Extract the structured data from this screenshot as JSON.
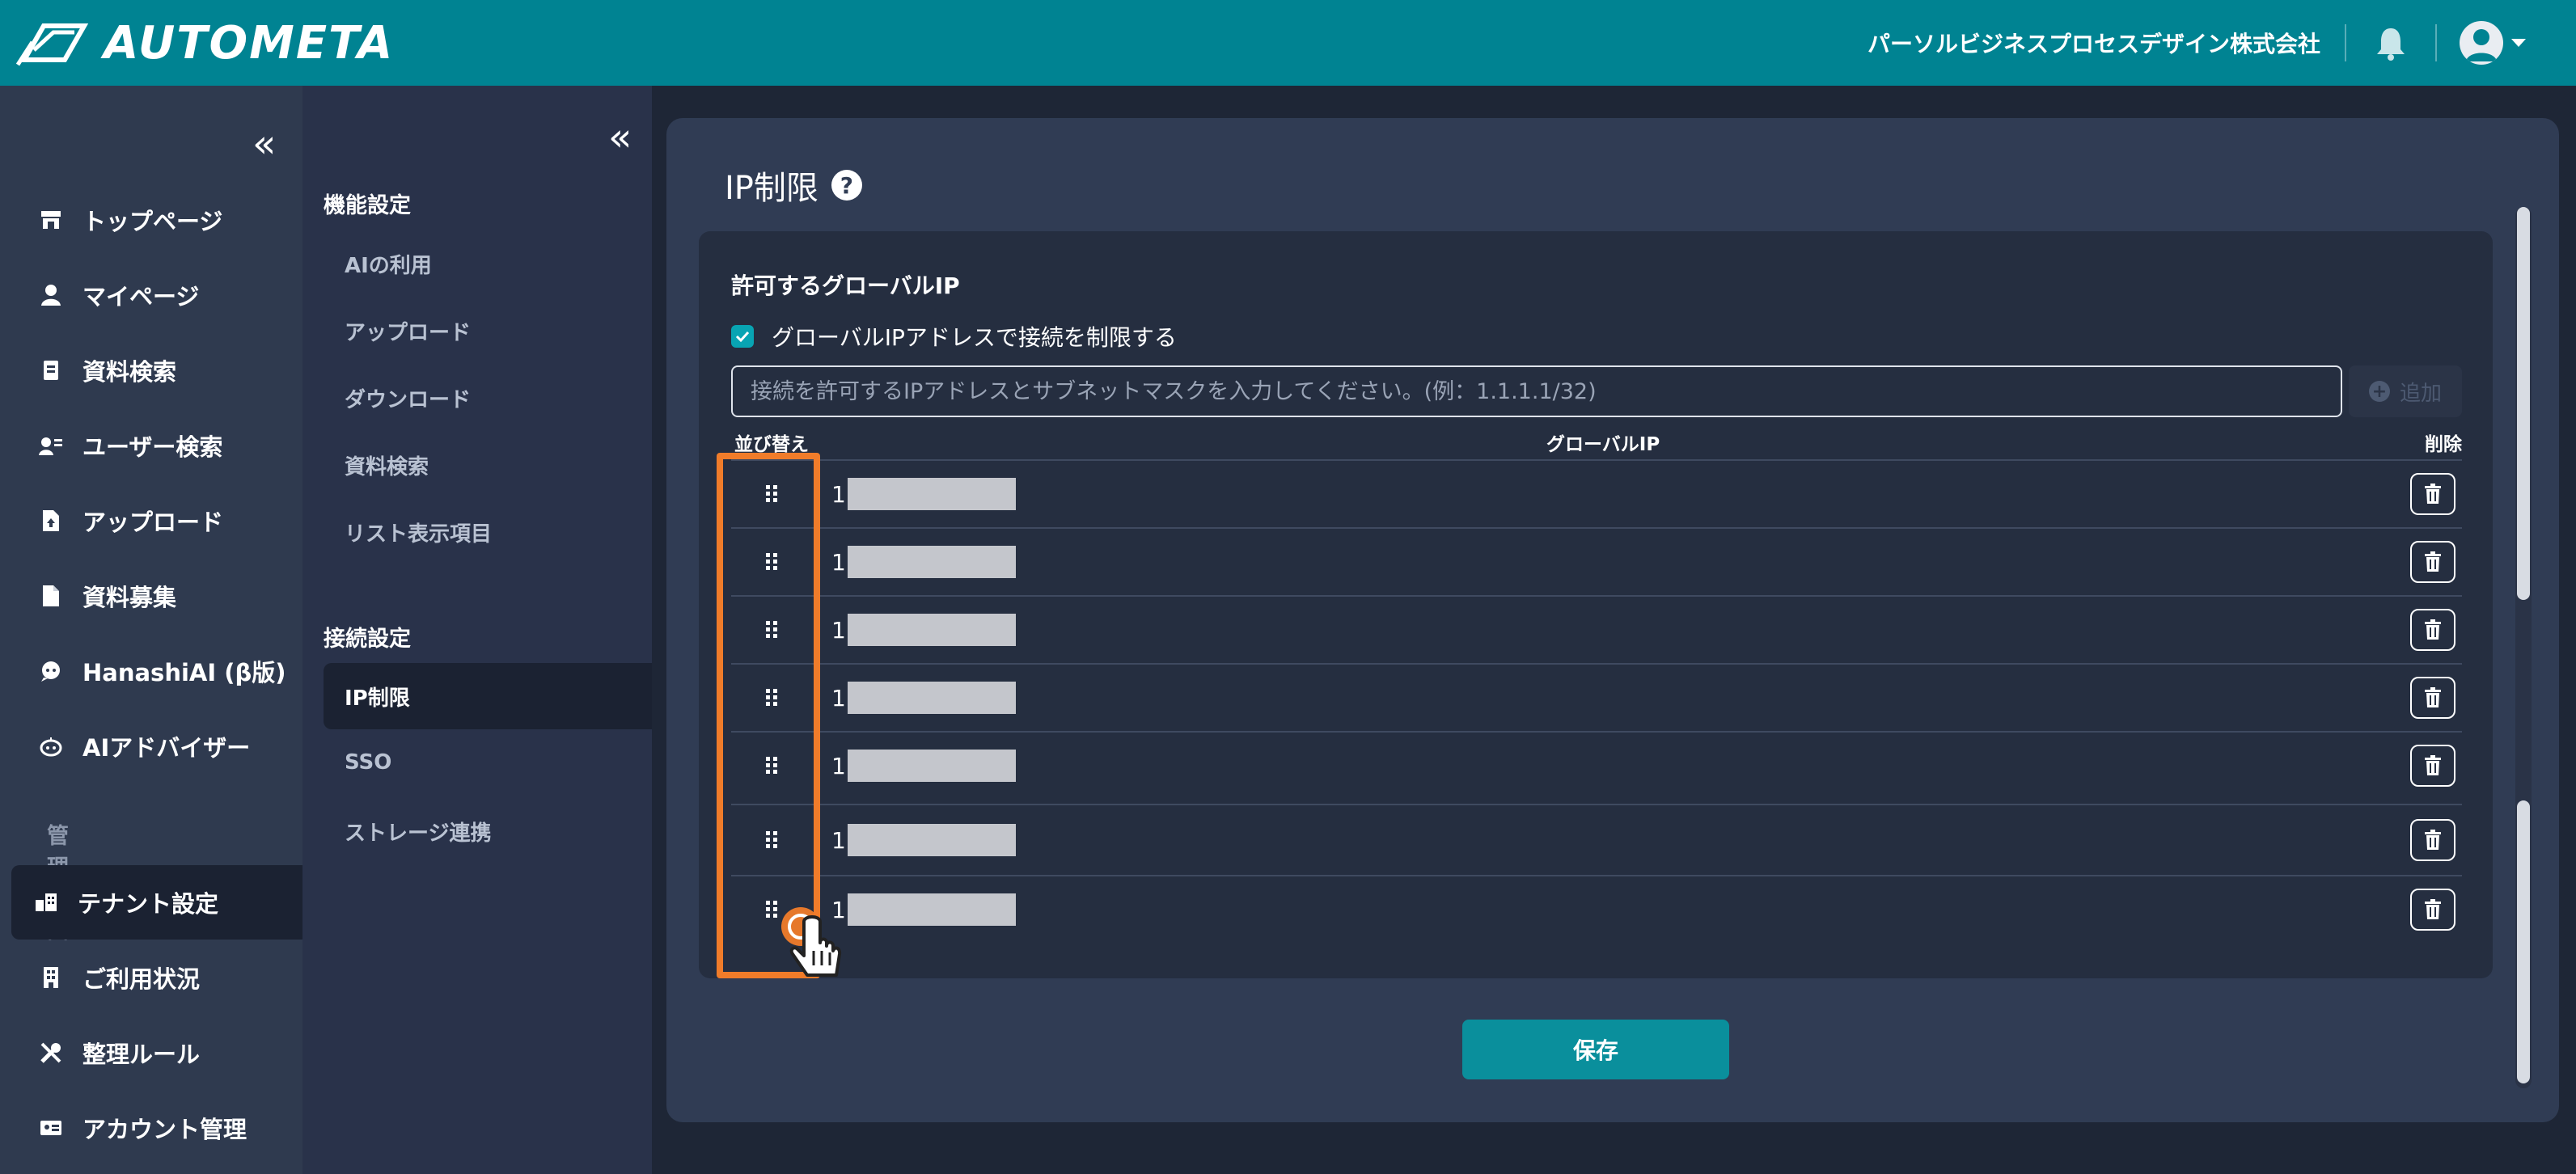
{
  "header": {
    "app_name": "AUTOMETA",
    "company": "パーソルビジネスプロセスデザイン株式会社"
  },
  "nav1": {
    "items": [
      {
        "label": "トップページ",
        "icon": "store-icon"
      },
      {
        "label": "マイページ",
        "icon": "person-icon"
      },
      {
        "label": "資料検索",
        "icon": "document-search-icon"
      },
      {
        "label": "ユーザー検索",
        "icon": "user-search-icon"
      },
      {
        "label": "アップロード",
        "icon": "file-upload-icon"
      },
      {
        "label": "資料募集",
        "icon": "file-icon"
      },
      {
        "label": "HanashiAI (β版)",
        "icon": "chat-icon"
      },
      {
        "label": "AIアドバイザー",
        "icon": "robot-icon"
      }
    ],
    "section_admin": "管理画面",
    "admin_items": [
      {
        "label": "テナント設定",
        "icon": "building-icon",
        "active": true
      },
      {
        "label": "ご利用状況",
        "icon": "office-icon"
      },
      {
        "label": "整理ルール",
        "icon": "tools-icon"
      },
      {
        "label": "アカウント管理",
        "icon": "id-card-icon"
      }
    ]
  },
  "nav2": {
    "section_features": "機能設定",
    "feature_items": [
      "AIの利用",
      "アップロード",
      "ダウンロード",
      "資料検索",
      "リスト表示項目"
    ],
    "section_connection": "接続設定",
    "connection_items": [
      "IP制限",
      "SSO",
      "ストレージ連携"
    ],
    "active": "IP制限"
  },
  "main": {
    "title": "IP制限",
    "help": "?",
    "section_title": "許可するグローバルIP",
    "restrict_checkbox_label": "グローバルIPアドレスで接続を制限する",
    "restrict_checked": true,
    "ip_input_placeholder": "接続を許可するIPアドレスとサブネットマスクを入力してください。(例：1.1.1.1/32)",
    "add_label": "追加",
    "table": {
      "columns": [
        "並び替え",
        "グローバルIP",
        "削除"
      ],
      "rows": [
        {
          "ip_prefix": "1"
        },
        {
          "ip_prefix": "1"
        },
        {
          "ip_prefix": "1"
        },
        {
          "ip_prefix": "1"
        },
        {
          "ip_prefix": "1"
        },
        {
          "ip_prefix": "1"
        },
        {
          "ip_prefix": "1"
        }
      ]
    },
    "save_label": "保存"
  },
  "colors": {
    "header": "#008392",
    "accent": "#0a8f9c",
    "highlight": "#f07c2a",
    "panel": "#303c54"
  }
}
